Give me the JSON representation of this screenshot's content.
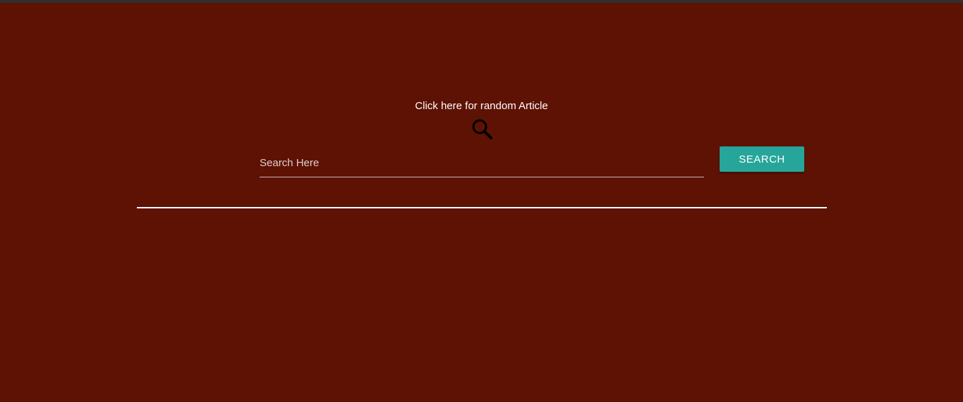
{
  "colors": {
    "background": "#5e1203",
    "accent": "#26a69a",
    "text": "#ffffff"
  },
  "random_article": {
    "label": "Click here for random Article"
  },
  "search": {
    "icon": "search-icon",
    "placeholder": "Search Here",
    "value": "",
    "button_label": "SEARCH"
  }
}
